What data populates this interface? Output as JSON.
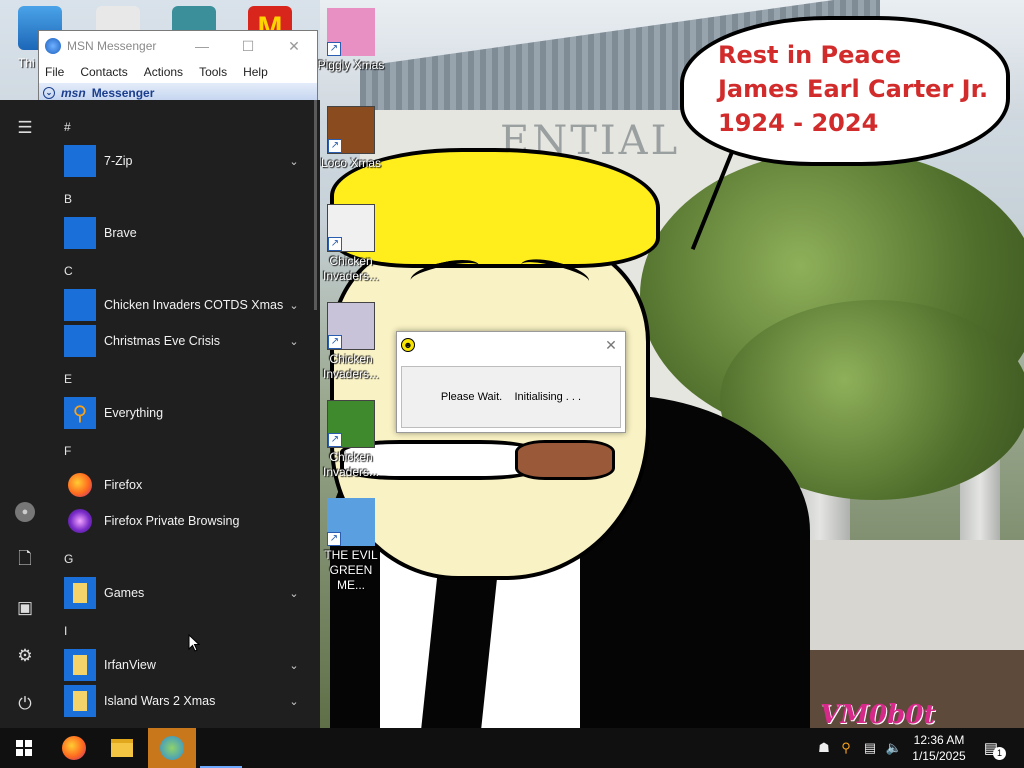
{
  "msn_window": {
    "title": "MSN Messenger",
    "menu": [
      "File",
      "Contacts",
      "Actions",
      "Tools",
      "Help"
    ],
    "banner_msn": "msn",
    "banner_label": "Messenger"
  },
  "desktop": {
    "partial_icon_label": "Thi",
    "icons": [
      {
        "label": "Piggly Xmas",
        "icon": "pig-icon"
      },
      {
        "label": "Loco Xmas",
        "icon": "teddy-bear-icon"
      },
      {
        "label": "Chicken Invaders...",
        "icon": "chicken-icon"
      },
      {
        "label": "Chicken Invaders...",
        "icon": "chicken-invaders-icon"
      },
      {
        "label": "Chicken Invaders...",
        "icon": "chicken-invaders-icon"
      },
      {
        "label": "THE EVIL GREEN ME...",
        "icon": "msn-people-icon"
      }
    ],
    "bubble_lines": [
      "Rest in Peace",
      "James Earl Carter Jr.",
      "1924 - 2024"
    ],
    "watermark": "VM0b0t"
  },
  "start_menu": {
    "groups": [
      {
        "letter": "#",
        "apps": [
          {
            "name": "7-Zip",
            "expandable": true,
            "tile": "#1a6fd8"
          }
        ]
      },
      {
        "letter": "B",
        "apps": [
          {
            "name": "Brave",
            "expandable": false,
            "tile": "#1a6fd8"
          }
        ]
      },
      {
        "letter": "C",
        "apps": [
          {
            "name": "Chicken Invaders COTDS Xmas",
            "expandable": true,
            "tile": "#1a6fd8"
          },
          {
            "name": "Christmas Eve Crisis",
            "expandable": true,
            "tile": "#1a6fd8"
          }
        ]
      },
      {
        "letter": "E",
        "apps": [
          {
            "name": "Everything",
            "expandable": false,
            "tile": "#1a6fd8"
          }
        ]
      },
      {
        "letter": "F",
        "apps": [
          {
            "name": "Firefox",
            "expandable": false,
            "tile": "none"
          },
          {
            "name": "Firefox Private Browsing",
            "expandable": false,
            "tile": "none"
          }
        ]
      },
      {
        "letter": "G",
        "apps": [
          {
            "name": "Games",
            "expandable": true,
            "tile": "#1a6fd8"
          }
        ]
      },
      {
        "letter": "I",
        "apps": [
          {
            "name": "IrfanView",
            "expandable": true,
            "tile": "#1a6fd8"
          },
          {
            "name": "Island Wars 2 Xmas",
            "expandable": true,
            "tile": "#1a6fd8"
          }
        ]
      }
    ],
    "rail": [
      "hamburger-icon",
      "user-avatar-icon",
      "documents-icon",
      "pictures-icon",
      "settings-icon",
      "power-icon"
    ]
  },
  "dialog": {
    "message": "Please Wait.    Initialising . . ."
  },
  "taskbar": {
    "apps": [
      "start-windows-icon",
      "firefox-icon",
      "file-explorer-icon",
      "msn-messenger-icon"
    ],
    "time": "12:36 AM",
    "date": "1/15/2025",
    "notification_count": "1"
  },
  "colors": {
    "start_bg": "#1f1f1f",
    "taskbar_bg": "#101010",
    "active_task": "#c9771b",
    "bubble_text": "#d12b2b",
    "tile_blue": "#1a6fd8"
  }
}
